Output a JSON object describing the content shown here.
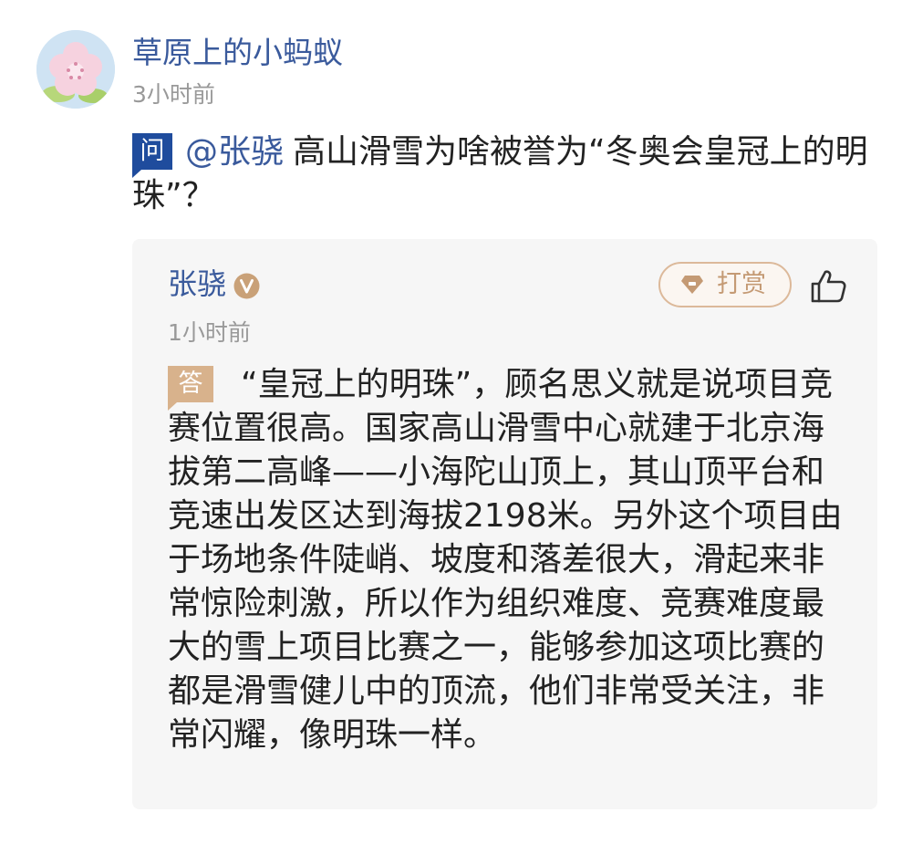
{
  "post": {
    "username": "草原上的小蚂蚁",
    "time": "3小时前"
  },
  "question": {
    "badge": "问",
    "mention": "@张骁",
    "text": "高山滑雪为啥被誉为“冬奥会皇冠上的明珠”？"
  },
  "answer": {
    "author": "张骁",
    "time": "1小时前",
    "tip_label": "打赏",
    "badge": "答",
    "text": "“皇冠上的明珠”，顾名思义就是说项目竞赛位置很高。国家高山滑雪中心就建于北京海拔第二高峰——小海陀山顶上，其山顶平台和竞速出发区达到海拔2198米。另外这个项目由于场地条件陡峭、坡度和落差很大，滑起来非常惊险刺激，所以作为组织难度、竞赛难度最大的雪上项目比赛之一，能够参加这项比赛的都是滑雪健儿中的顶流，他们非常受关注，非常闪耀，像明珠一样。"
  },
  "icons": {
    "avatar": "cherry-blossom-avatar",
    "verified": "verified-v-icon",
    "tip": "gem-icon",
    "like": "thumbs-up-icon"
  },
  "colors": {
    "link_blue": "#3a5a9c",
    "question_badge": "#1f4c9d",
    "answer_badge": "#d8b28c",
    "tip_accent": "#c49a74",
    "card_background": "#f6f6f6"
  }
}
